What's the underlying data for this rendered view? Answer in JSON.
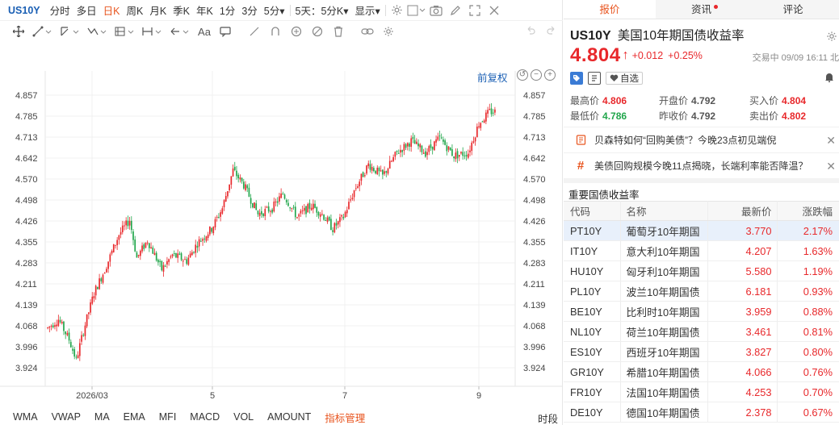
{
  "period_bar": {
    "symbol": "US10Y",
    "items": [
      "分时",
      "多日",
      "日K",
      "周K",
      "月K",
      "季K",
      "年K",
      "1分",
      "3分",
      "5分▾",
      "5天：5分K▾",
      "显示▾"
    ],
    "active": "日K"
  },
  "chart": {
    "fuquan_label": "前复权",
    "x_tick_labels": [
      "2026/03",
      "5",
      "7",
      "9"
    ],
    "y_tick_labels": [
      "4.857",
      "4.785",
      "4.713",
      "4.642",
      "4.570",
      "4.498",
      "4.426",
      "4.355",
      "4.283",
      "4.211",
      "4.139",
      "4.068",
      "3.996",
      "3.924"
    ],
    "colors": {
      "up": "#e8282b",
      "down": "#21a64b",
      "grid": "#f0f0f0"
    }
  },
  "indicators": {
    "items": [
      "WMA",
      "VWAP",
      "MA",
      "EMA",
      "MFI",
      "MACD",
      "VOL",
      "AMOUNT",
      "指标管理"
    ],
    "time_label": "时段"
  },
  "tabs": [
    {
      "label": "报价",
      "active": true
    },
    {
      "label": "资讯",
      "active": false,
      "dot": true
    },
    {
      "label": "评论",
      "active": false
    }
  ],
  "quote": {
    "symbol": "US10Y",
    "name": "美国10年期国债收益率",
    "price": "4.804",
    "change": "+0.012",
    "change_pct": "+0.25%",
    "status": "交易中 09/09 16:11 北",
    "fav_label": "自选",
    "stats": [
      {
        "label": "最高价",
        "value": "4.806",
        "tone": "red"
      },
      {
        "label": "开盘价",
        "value": "4.792",
        "tone": "gray"
      },
      {
        "label": "买入价",
        "value": "4.804",
        "tone": "red"
      },
      {
        "label": "最低价",
        "value": "4.786",
        "tone": "green"
      },
      {
        "label": "昨收价",
        "value": "4.792",
        "tone": "gray"
      },
      {
        "label": "卖出价",
        "value": "4.802",
        "tone": "red"
      }
    ]
  },
  "news": [
    {
      "icon": "document-icon",
      "text": "贝森特如何“回购美债”？今晚23点初见端倪"
    },
    {
      "icon": "hashtag-icon",
      "text": "美债回购规模今晚11点揭晓，长端利率能否降温？"
    }
  ],
  "bond_section": {
    "title": "重要国债收益率",
    "headers": [
      "代码",
      "名称",
      "最新价",
      "涨跌幅"
    ],
    "rows": [
      {
        "code": "PT10Y",
        "name": "葡萄牙10年期国",
        "price": "3.770",
        "pct": "2.17%"
      },
      {
        "code": "IT10Y",
        "name": "意大利10年期国",
        "price": "4.207",
        "pct": "1.63%"
      },
      {
        "code": "HU10Y",
        "name": "匈牙利10年期国",
        "price": "5.580",
        "pct": "1.19%"
      },
      {
        "code": "PL10Y",
        "name": "波兰10年期国债",
        "price": "6.181",
        "pct": "0.93%"
      },
      {
        "code": "BE10Y",
        "name": "比利时10年期国",
        "price": "3.959",
        "pct": "0.88%"
      },
      {
        "code": "NL10Y",
        "name": "荷兰10年期国债",
        "price": "3.461",
        "pct": "0.81%"
      },
      {
        "code": "ES10Y",
        "name": "西班牙10年期国",
        "price": "3.827",
        "pct": "0.80%"
      },
      {
        "code": "GR10Y",
        "name": "希腊10年期国债",
        "price": "4.066",
        "pct": "0.76%"
      },
      {
        "code": "FR10Y",
        "name": "法国10年期国债",
        "price": "4.253",
        "pct": "0.70%"
      },
      {
        "code": "DE10Y",
        "name": "德国10年期国债",
        "price": "2.378",
        "pct": "0.67%"
      }
    ]
  }
}
